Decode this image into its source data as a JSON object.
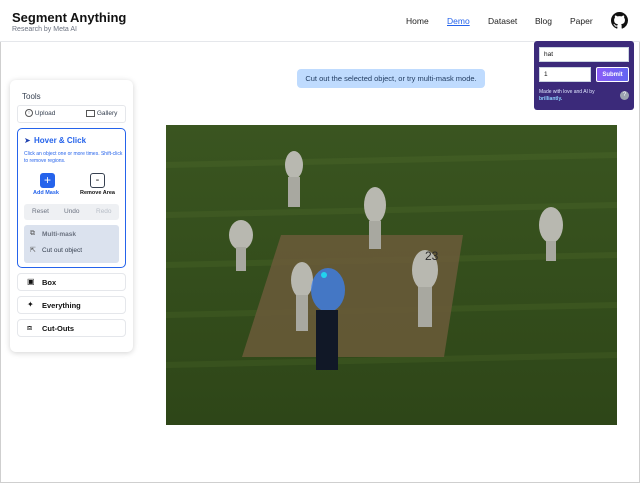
{
  "header": {
    "title": "Segment Anything",
    "subtitle": "Research by Meta AI",
    "nav": [
      "Home",
      "Demo",
      "Dataset",
      "Blog",
      "Paper"
    ],
    "active_nav": "Demo",
    "github_icon": "github-icon"
  },
  "overlay": {
    "text_input_value": "hat",
    "number_input_value": "1",
    "submit_label": "Submit",
    "made_with": "Made with love and AI by",
    "brand": "brilliantly.",
    "help_label": "?"
  },
  "sidebar": {
    "tools_label": "Tools",
    "upload_label": "Upload",
    "gallery_label": "Gallery",
    "hover_click": {
      "title": "Hover & Click",
      "description": "Click an object one or more times. Shift-click to remove regions.",
      "add_mask_label": "Add Mask",
      "add_mask_symbol": "+",
      "remove_area_label": "Remove Area",
      "remove_area_symbol": "-",
      "reset_label": "Reset",
      "undo_label": "Undo",
      "redo_label": "Redo",
      "multimask_label": "Multi-mask",
      "cutout_label": "Cut out object"
    },
    "box_label": "Box",
    "everything_label": "Everything",
    "cutouts_label": "Cut-Outs"
  },
  "hint": "Cut out the selected object, or try multi-mask mode.",
  "image": {
    "description_icon": "cricket-photo",
    "jersey_number": "23",
    "colors": {
      "field": "#3f5a1f",
      "pitch": "#6b5a3a",
      "highlight": "#3b82f6"
    }
  }
}
